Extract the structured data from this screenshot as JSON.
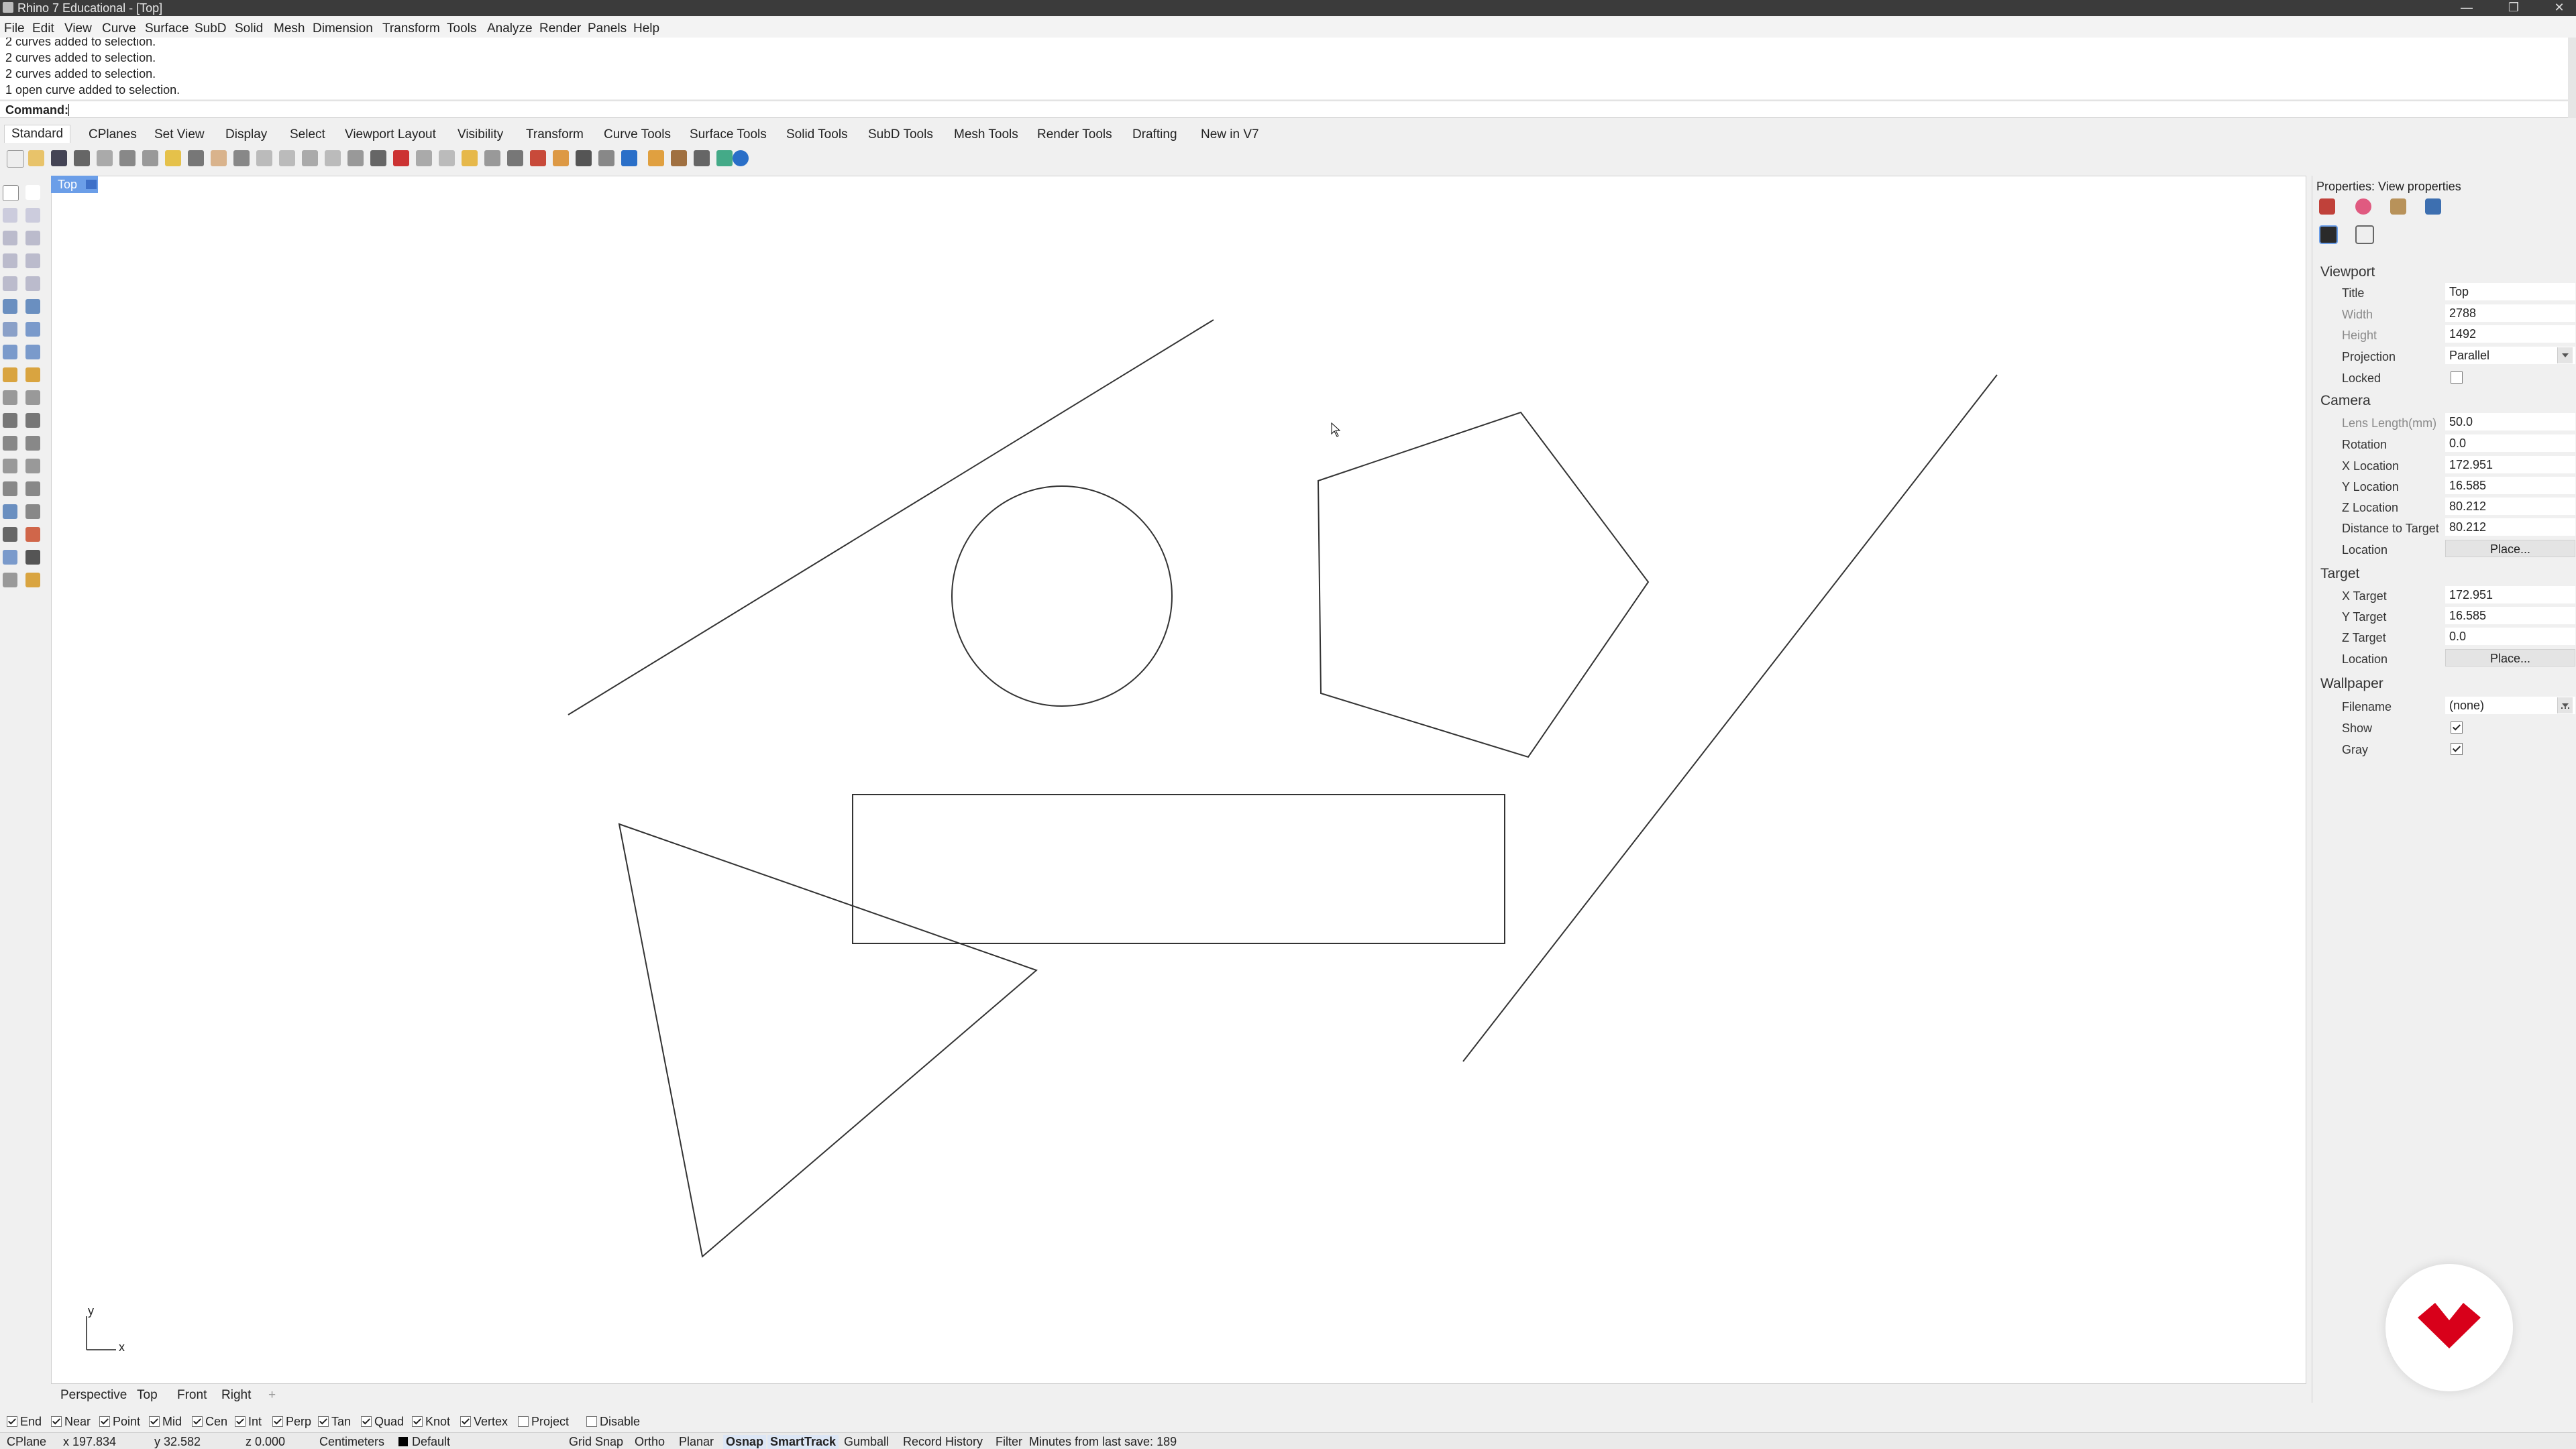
{
  "window": {
    "title": "Rhino 7 Educational - [Top]"
  },
  "menu": [
    "File",
    "Edit",
    "View",
    "Curve",
    "Surface",
    "SubD",
    "Solid",
    "Mesh",
    "Dimension",
    "Transform",
    "Tools",
    "Analyze",
    "Render",
    "Panels",
    "Help"
  ],
  "command_history": [
    "2 curves added to selection.",
    "2 curves added to selection.",
    "2 curves added to selection.",
    "1 open curve added to selection."
  ],
  "command_prompt": "Command:",
  "toolbar_tabs": [
    "Standard",
    "CPlanes",
    "Set View",
    "Display",
    "Select",
    "Viewport Layout",
    "Visibility",
    "Transform",
    "Curve Tools",
    "Surface Tools",
    "Solid Tools",
    "SubD Tools",
    "Mesh Tools",
    "Render Tools",
    "Drafting",
    "New in V7"
  ],
  "viewport": {
    "name": "Top",
    "axis_y": "y",
    "axis_x": "x"
  },
  "view_tabs": [
    "Perspective",
    "Top",
    "Front",
    "Right"
  ],
  "view_tab_add": "+",
  "osnaps": [
    {
      "label": "End",
      "on": true
    },
    {
      "label": "Near",
      "on": true
    },
    {
      "label": "Point",
      "on": true
    },
    {
      "label": "Mid",
      "on": true
    },
    {
      "label": "Cen",
      "on": true
    },
    {
      "label": "Int",
      "on": true
    },
    {
      "label": "Perp",
      "on": true
    },
    {
      "label": "Tan",
      "on": true
    },
    {
      "label": "Quad",
      "on": true
    },
    {
      "label": "Knot",
      "on": true
    },
    {
      "label": "Vertex",
      "on": true
    },
    {
      "label": "Project",
      "on": false
    },
    {
      "label": "Disable",
      "on": false
    }
  ],
  "status": {
    "cplane": "CPlane",
    "x": "x 197.834",
    "y": "y 32.582",
    "z": "z 0.000",
    "units": "Centimeters",
    "layer": "Default",
    "grid_snap": "Grid Snap",
    "ortho": "Ortho",
    "planar": "Planar",
    "osnap": "Osnap",
    "smarttrack": "SmartTrack",
    "gumball": "Gumball",
    "record_history": "Record History",
    "filter": "Filter",
    "last_save": "Minutes from last save: 189"
  },
  "properties": {
    "header": "Properties: View properties",
    "viewport_section": "Viewport",
    "title_label": "Title",
    "title_value": "Top",
    "width_label": "Width",
    "width_value": "2788",
    "height_label": "Height",
    "height_value": "1492",
    "projection_label": "Projection",
    "projection_value": "Parallel",
    "locked_label": "Locked",
    "camera_section": "Camera",
    "lens_label": "Lens Length(mm)",
    "lens_value": "50.0",
    "rotation_label": "Rotation",
    "rotation_value": "0.0",
    "xloc_label": "X Location",
    "xloc_value": "172.951",
    "yloc_label": "Y Location",
    "yloc_value": "16.585",
    "zloc_label": "Z Location",
    "zloc_value": "80.212",
    "dist_label": "Distance to Target",
    "dist_value": "80.212",
    "cam_location_label": "Location",
    "place_button": "Place...",
    "target_section": "Target",
    "xt_label": "X Target",
    "xt_value": "172.951",
    "yt_label": "Y Target",
    "yt_value": "16.585",
    "zt_label": "Z Target",
    "zt_value": "0.0",
    "tgt_location_label": "Location",
    "wallpaper_section": "Wallpaper",
    "filename_label": "Filename",
    "filename_value": "(none)",
    "browse_button": "...",
    "show_label": "Show",
    "gray_label": "Gray"
  },
  "colors": {
    "accent": "#6b9ee8",
    "logo": "#d8001a",
    "background": "#ffffff"
  }
}
